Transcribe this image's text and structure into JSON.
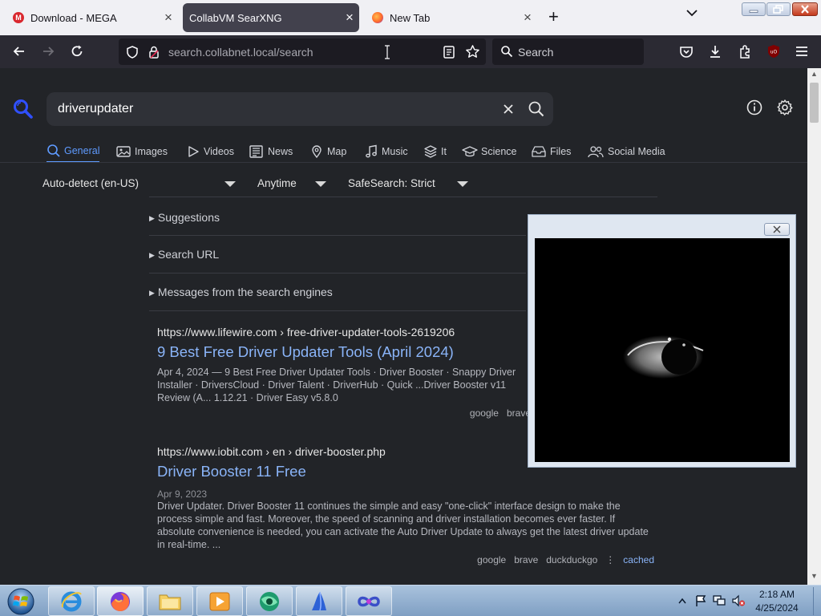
{
  "browser": {
    "tabs": [
      {
        "title": "Download - MEGA",
        "favicon": "mega-icon"
      },
      {
        "title": "CollabVM SearXNG",
        "favicon": "none",
        "active": true
      },
      {
        "title": "New Tab",
        "favicon": "firefox-icon"
      }
    ],
    "url": {
      "domain": "search.collabnet.local",
      "path": "/search"
    },
    "search_placeholder": "Search"
  },
  "search": {
    "query": "driverupdater",
    "categories": [
      "General",
      "Images",
      "Videos",
      "News",
      "Map",
      "Music",
      "It",
      "Science",
      "Files",
      "Social Media"
    ],
    "active_category": "General",
    "filters": {
      "language": "Auto-detect (en-US)",
      "time": "Anytime",
      "safesearch": "SafeSearch: Strict"
    },
    "sections": [
      "Suggestions",
      "Search URL",
      "Messages from the search engines"
    ]
  },
  "results": [
    {
      "url_host": "https://www.lifewire.com",
      "url_path": " › free-driver-updater-tools-2619206",
      "title": "9 Best Free Driver Updater Tools (April 2024)",
      "date": "",
      "desc": "Apr 4, 2024 — 9 Best Free Driver Updater Tools · Driver Booster · Snappy Driver Installer · DriversCloud · Driver Talent · DriverHub · Quick ...Driver Booster v11 Review (A... 1.12.21 · Driver Easy v5.8.0",
      "engines": [
        "google",
        "brave"
      ],
      "cached": ""
    },
    {
      "url_host": "https://www.iobit.com",
      "url_path": " › en › driver-booster.php",
      "title": "Driver Booster 11 Free",
      "date": "Apr 9, 2023",
      "desc": "Driver Updater. Driver Booster 11 continues the simple and easy \"one-click\" interface design to make the process simple and fast. Moreover, the speed of scanning and driver installation becomes ever faster. If absolute convenience is needed, you can activate the Auto Driver Update to always get the latest driver update in real-time. ...",
      "engines": [
        "google",
        "brave",
        "duckduckgo"
      ],
      "cached": "cached"
    }
  ],
  "taskbar": {
    "time": "2:18 AM",
    "date": "4/25/2024"
  },
  "colors": {
    "accent": "#5f9bff",
    "link": "#8ab4f8",
    "page_bg": "#222428"
  }
}
